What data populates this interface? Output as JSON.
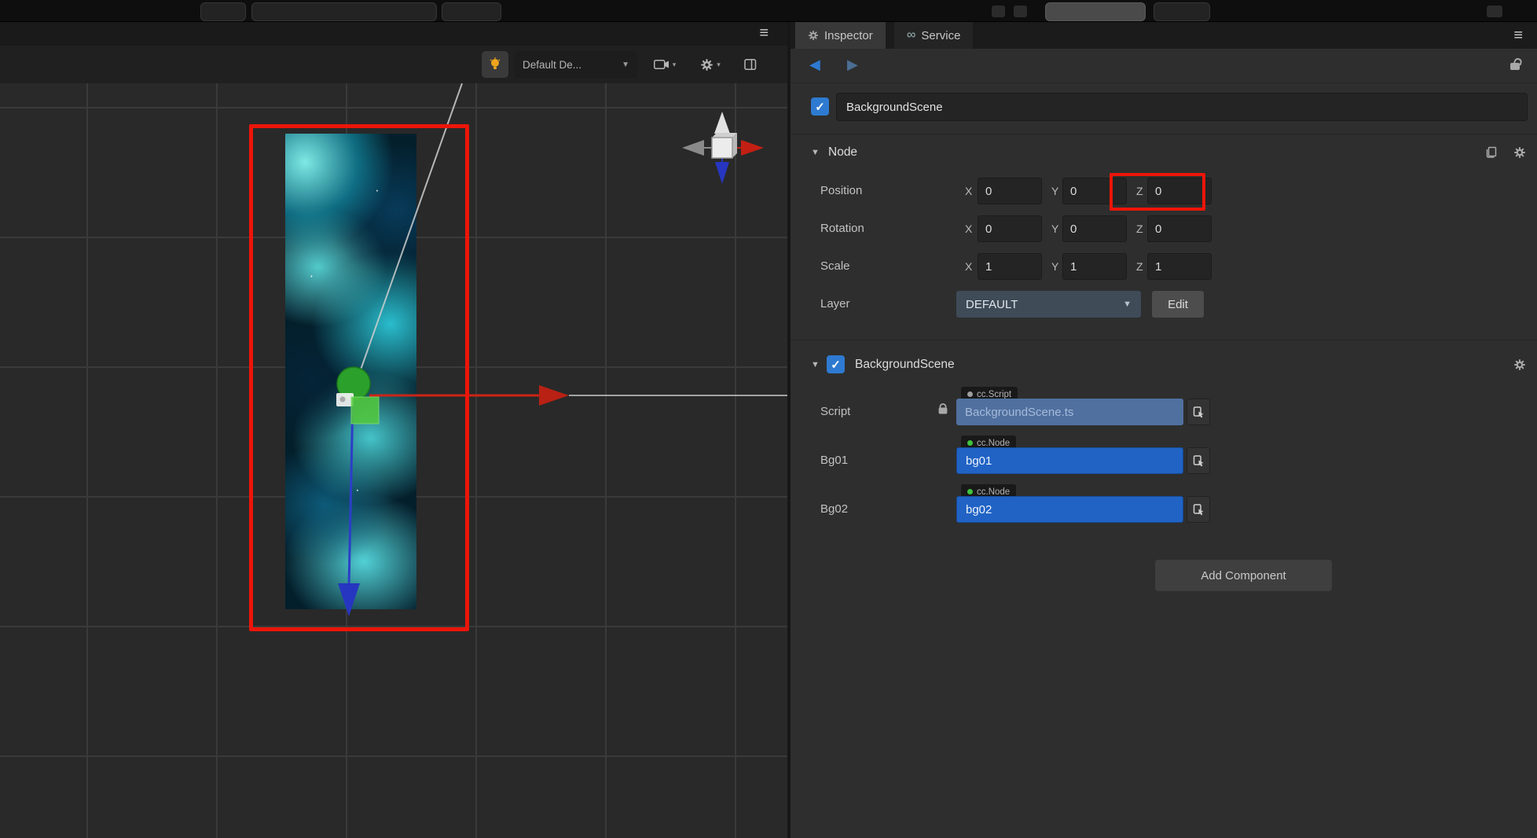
{
  "colors": {
    "annotation_red": "#ec1509",
    "checkbox_blue": "#2e7ad1",
    "node_ref_blue": "#2063c5",
    "script_ref_blue": "#50709f",
    "node_badge_green": "#3fc43f",
    "axis_red": "#c32014",
    "axis_blue": "#2636c0",
    "gizmo_green": "#2ba02b"
  },
  "icons": {
    "menu": "≡",
    "caret": "▼",
    "caret_small": "▾",
    "triangle_expanded": "▼",
    "back": "◀",
    "forward": "▶",
    "service": "∞",
    "check": "✓"
  },
  "scene": {
    "toolbar": {
      "device_dropdown": "Default De..."
    }
  },
  "inspector": {
    "tabs": {
      "inspector": "Inspector",
      "service": "Service"
    },
    "header": {
      "name": "BackgroundScene"
    },
    "node": {
      "title": "Node",
      "position": {
        "label": "Position",
        "axes": [
          "X",
          "Y",
          "Z"
        ],
        "values": [
          "0",
          "0",
          "0"
        ]
      },
      "rotation": {
        "label": "Rotation",
        "axes": [
          "X",
          "Y",
          "Z"
        ],
        "values": [
          "0",
          "0",
          "0"
        ]
      },
      "scale": {
        "label": "Scale",
        "axes": [
          "X",
          "Y",
          "Z"
        ],
        "values": [
          "1",
          "1",
          "1"
        ]
      },
      "layer": {
        "label": "Layer",
        "value": "DEFAULT",
        "edit_label": "Edit"
      }
    },
    "component": {
      "title": "BackgroundScene",
      "script_row": {
        "label": "Script",
        "badge": "cc.Script",
        "value": "BackgroundScene.ts"
      },
      "bg01_row": {
        "label": "Bg01",
        "badge": "cc.Node",
        "value": "bg01"
      },
      "bg02_row": {
        "label": "Bg02",
        "badge": "cc.Node",
        "value": "bg02"
      }
    },
    "add_component_label": "Add Component"
  }
}
